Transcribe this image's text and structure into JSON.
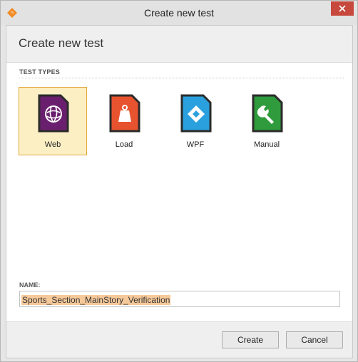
{
  "window": {
    "title": "Create new test",
    "icon": "app-logo-icon",
    "close_icon": "close-icon"
  },
  "dialog": {
    "header_title": "Create new test",
    "section_label": "TEST TYPES",
    "test_types": [
      {
        "label": "Web",
        "icon": "globe-icon",
        "color": "#6a1f6e",
        "selected": true
      },
      {
        "label": "Load",
        "icon": "weight-icon",
        "color": "#e8532f",
        "selected": false
      },
      {
        "label": "WPF",
        "icon": "diamond-icon",
        "color": "#2aa0de",
        "selected": false
      },
      {
        "label": "Manual",
        "icon": "wrench-icon",
        "color": "#2f9b3c",
        "selected": false
      }
    ],
    "name_label": "NAME:",
    "name_value": "Sports_Section_MainStory_Verification",
    "buttons": {
      "create": "Create",
      "cancel": "Cancel"
    }
  },
  "colors": {
    "accent": "#e2a53e",
    "selection": "#fcefc4",
    "close": "#c7483c"
  }
}
